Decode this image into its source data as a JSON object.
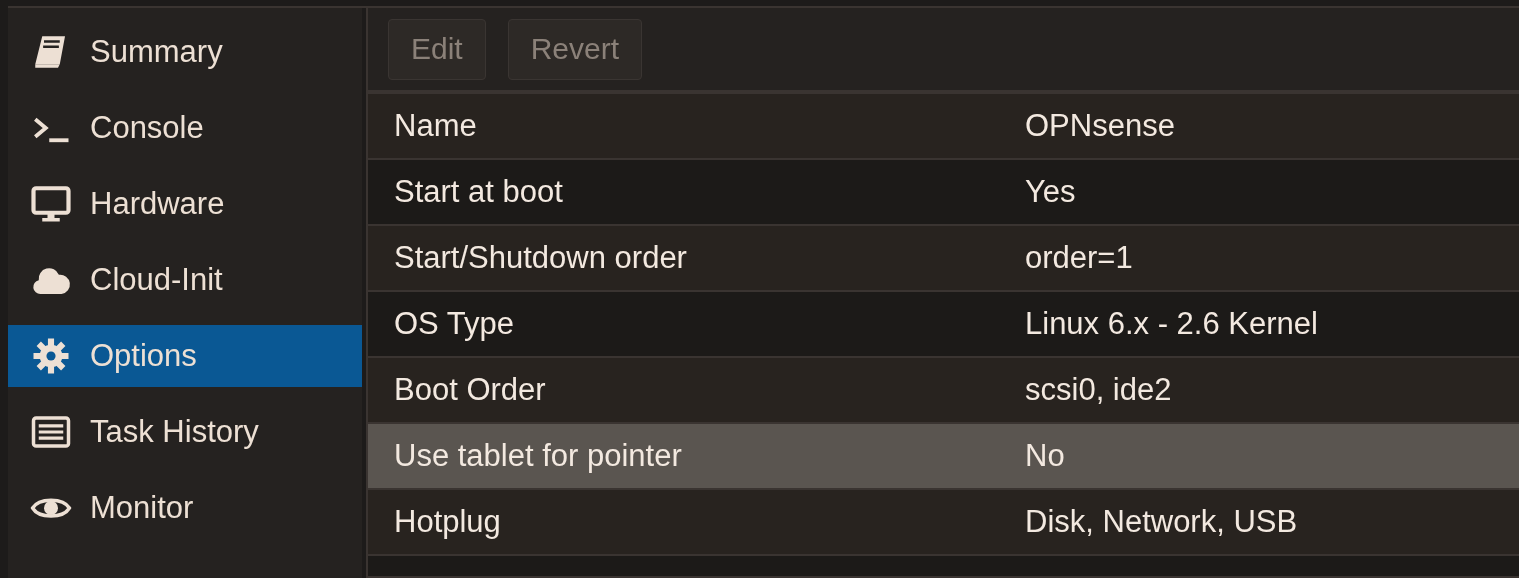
{
  "sidebar": {
    "items": [
      {
        "label": "Summary",
        "selected": false
      },
      {
        "label": "Console",
        "selected": false
      },
      {
        "label": "Hardware",
        "selected": false
      },
      {
        "label": "Cloud-Init",
        "selected": false
      },
      {
        "label": "Options",
        "selected": true
      },
      {
        "label": "Task History",
        "selected": false
      },
      {
        "label": "Monitor",
        "selected": false
      }
    ]
  },
  "toolbar": {
    "buttons": [
      {
        "label": "Edit",
        "disabled": true
      },
      {
        "label": "Revert",
        "disabled": true
      }
    ]
  },
  "table": {
    "rows": [
      {
        "key": "Name",
        "value": "OPNsense",
        "selected": false
      },
      {
        "key": "Start at boot",
        "value": "Yes",
        "selected": false
      },
      {
        "key": "Start/Shutdown order",
        "value": "order=1",
        "selected": false
      },
      {
        "key": "OS Type",
        "value": "Linux 6.x - 2.6 Kernel",
        "selected": false
      },
      {
        "key": "Boot Order",
        "value": "scsi0, ide2",
        "selected": false
      },
      {
        "key": "Use tablet for pointer",
        "value": "No",
        "selected": true
      },
      {
        "key": "Hotplug",
        "value": "Disk, Network, USB",
        "selected": false
      }
    ]
  }
}
